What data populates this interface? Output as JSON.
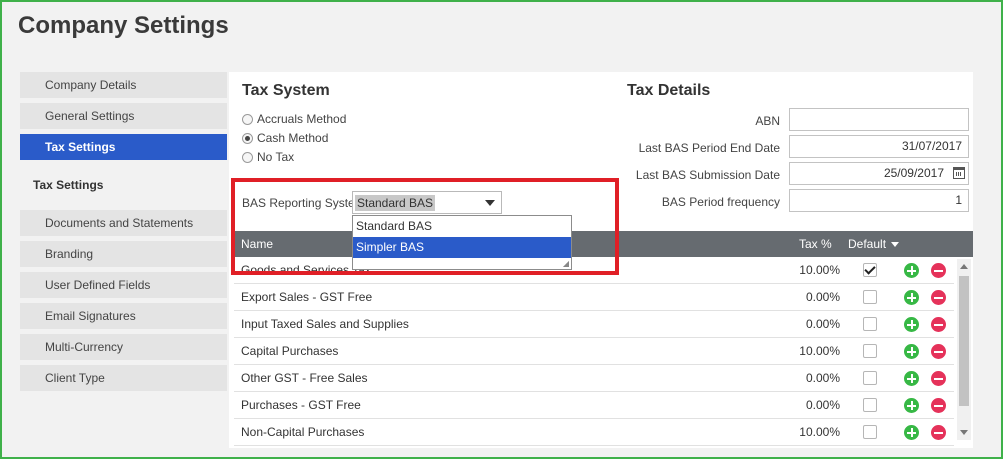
{
  "page": {
    "title": "Company Settings"
  },
  "sidebar": {
    "items": [
      {
        "label": "Company Details"
      },
      {
        "label": "General Settings"
      },
      {
        "label": "Tax Settings",
        "active": true
      },
      {
        "label": "Documents and Statements"
      },
      {
        "label": "Branding"
      },
      {
        "label": "User Defined Fields"
      },
      {
        "label": "Email Signatures"
      },
      {
        "label": "Multi-Currency"
      },
      {
        "label": "Client Type"
      }
    ],
    "section_label": "Tax Settings"
  },
  "tax_system": {
    "heading": "Tax System",
    "options": [
      {
        "label": "Accruals Method",
        "checked": false
      },
      {
        "label": "Cash Method",
        "checked": true
      },
      {
        "label": "No Tax",
        "checked": false
      }
    ],
    "bas_label": "BAS Reporting System",
    "bas_value": "Standard BAS",
    "bas_options": [
      "Standard BAS",
      "Simpler BAS"
    ],
    "bas_highlighted": "Simpler BAS"
  },
  "tax_details": {
    "heading": "Tax Details",
    "abn_label": "ABN",
    "abn_value": "",
    "last_period_end_label": "Last BAS Period End Date",
    "last_period_end_value": "31/07/2017",
    "last_submission_label": "Last BAS Submission Date",
    "last_submission_value": "25/09/2017",
    "frequency_label": "BAS Period frequency",
    "frequency_value": "1"
  },
  "table": {
    "col_name": "Name",
    "col_tax": "Tax %",
    "col_default": "Default",
    "rows": [
      {
        "name": "Goods and Services Tax",
        "tax": "10.00%",
        "default": true
      },
      {
        "name": "Export Sales - GST Free",
        "tax": "0.00%",
        "default": false
      },
      {
        "name": "Input Taxed Sales and Supplies",
        "tax": "0.00%",
        "default": false
      },
      {
        "name": "Capital Purchases",
        "tax": "10.00%",
        "default": false
      },
      {
        "name": "Other GST - Free Sales",
        "tax": "0.00%",
        "default": false
      },
      {
        "name": "Purchases - GST Free",
        "tax": "0.00%",
        "default": false
      },
      {
        "name": "Non-Capital Purchases",
        "tax": "10.00%",
        "default": false
      }
    ]
  },
  "colors": {
    "accent": "#2a5bc9",
    "frame": "#3fb14a",
    "highlight_box": "#e01f26",
    "add": "#37b845",
    "delete": "#e5325a"
  }
}
